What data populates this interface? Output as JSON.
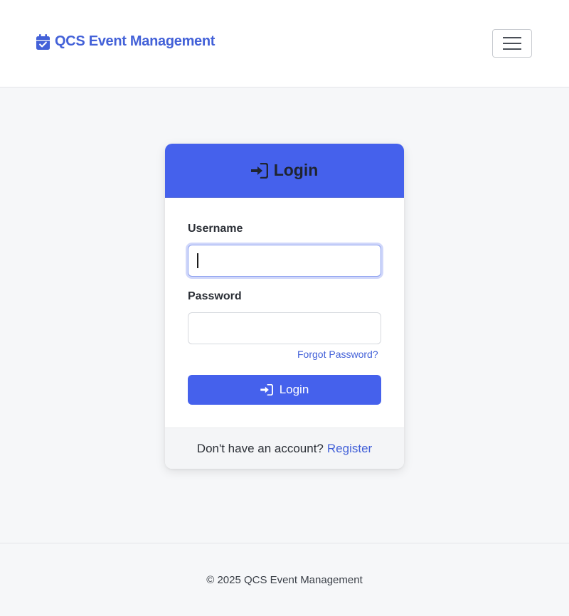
{
  "navbar": {
    "brand_text": "QCS Event Management",
    "brand_icon": "calendar-check-icon",
    "toggle_icon": "hamburger-menu-icon"
  },
  "login_card": {
    "header_title": "Login",
    "header_icon": "sign-in-icon",
    "username_label": "Username",
    "username_value": "",
    "password_label": "Password",
    "password_value": "",
    "forgot_password_text": "Forgot Password?",
    "submit_label": "Login",
    "footer_text": "Don't have an account?",
    "register_text": "Register"
  },
  "footer": {
    "copyright": "© 2025 QCS Event Management"
  },
  "colors": {
    "primary": "#4561ec",
    "link": "#4361d8",
    "page_background": "#f6f7f9"
  }
}
